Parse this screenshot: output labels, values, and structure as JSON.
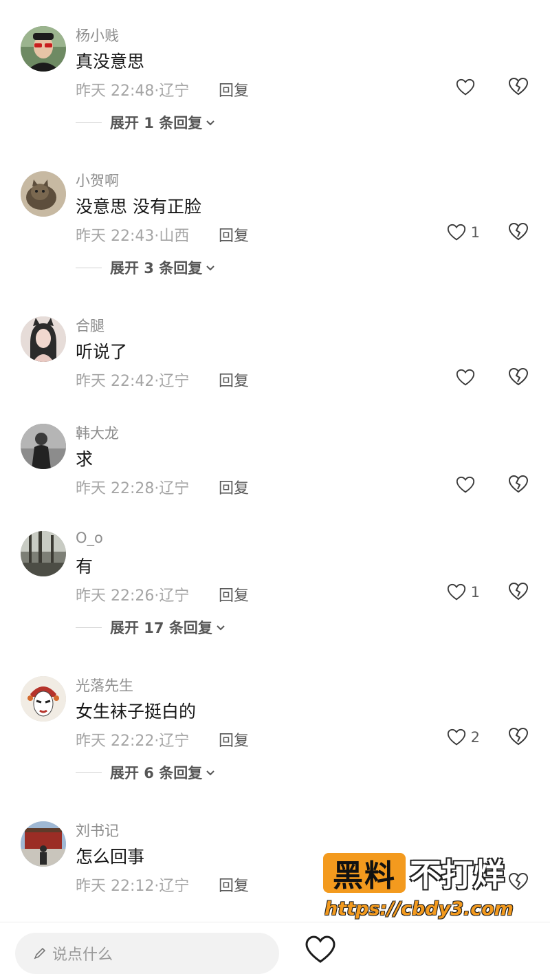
{
  "comments": [
    {
      "username": "杨小贱",
      "text": "真没意思",
      "time": "昨天 22:48",
      "location": "辽宁",
      "reply_label": "回复",
      "likes": "",
      "expand": "展开 1 条回复",
      "avatar": "man-red-sunglasses"
    },
    {
      "username": "小贺啊",
      "text": "没意思 没有正脸",
      "time": "昨天 22:43",
      "location": "山西",
      "reply_label": "回复",
      "likes": "1",
      "expand": "展开 3 条回复",
      "avatar": "cat"
    },
    {
      "username": "合腿",
      "text": "听说了",
      "time": "昨天 22:42",
      "location": "辽宁",
      "reply_label": "回复",
      "likes": "",
      "expand": "",
      "avatar": "woman-cat-ears"
    },
    {
      "username": "韩大龙",
      "text": "求",
      "time": "昨天 22:28",
      "location": "辽宁",
      "reply_label": "回复",
      "likes": "",
      "expand": "",
      "avatar": "man-bw"
    },
    {
      "username": "O_o",
      "text": "有",
      "time": "昨天 22:26",
      "location": "辽宁",
      "reply_label": "回复",
      "likes": "1",
      "expand": "展开 17 条回复",
      "avatar": "forest"
    },
    {
      "username": "光落先生",
      "text": "女生袜子挺白的",
      "time": "昨天 22:22",
      "location": "辽宁",
      "reply_label": "回复",
      "likes": "2",
      "expand": "展开 6 条回复",
      "avatar": "opera-mask"
    },
    {
      "username": "刘书记",
      "text": "怎么回事",
      "time": "昨天 22:12",
      "location": "辽宁",
      "reply_label": "回复",
      "likes": "",
      "expand": "",
      "avatar": "man-at-gate"
    }
  ],
  "watermark": {
    "left": "黑料",
    "right": "不打烊",
    "url": "https://cbdy3.com"
  },
  "bottom_bar": {
    "input_placeholder": "说点什么"
  }
}
